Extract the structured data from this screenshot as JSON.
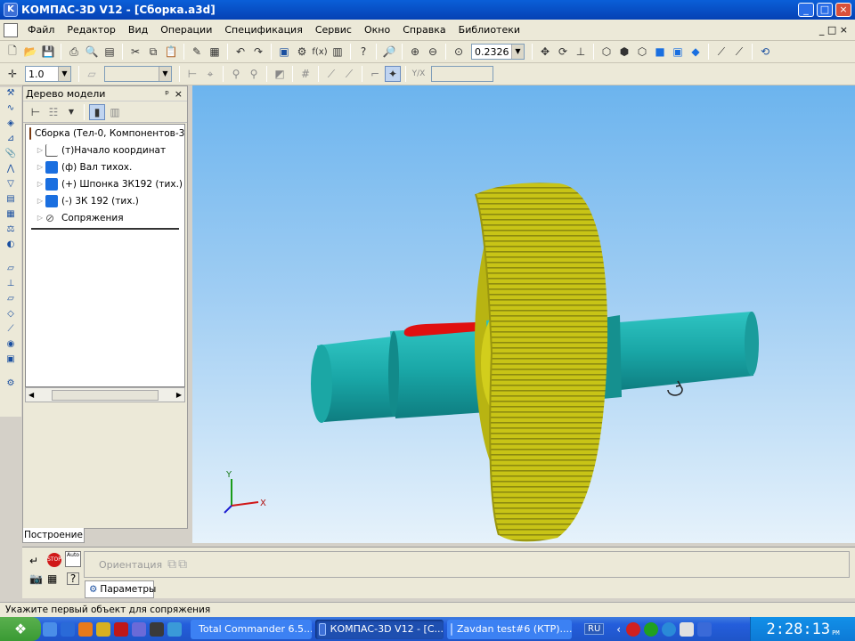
{
  "window": {
    "title": "КОМПАС-3D V12 - [Сборка.a3d]",
    "min": "_",
    "max": "□",
    "close": "×"
  },
  "menu": {
    "items": [
      "Файл",
      "Редактор",
      "Вид",
      "Операции",
      "Спецификация",
      "Сервис",
      "Окно",
      "Справка",
      "Библиотеки"
    ],
    "restore": "_ □ ×"
  },
  "toolbar1": {
    "zoom_value": "0.2326"
  },
  "toolbar2": {
    "step_value": "1.0"
  },
  "tree": {
    "title": "Дерево модели",
    "pin": "ᵖ",
    "close": "×",
    "items": [
      {
        "label": "Сборка (Тел-0, Компонентов-3)"
      },
      {
        "label": "(т)Начало координат"
      },
      {
        "label": "(ф) Вал тихох."
      },
      {
        "label": "(+) Шпонка 3К192 (тих.)"
      },
      {
        "label": "(-) 3К 192 (тих.)"
      },
      {
        "label": "Сопряжения"
      }
    ]
  },
  "tab_construct": "Построение",
  "props": {
    "orientation_label": "Ориентация",
    "params_tab": "Параметры"
  },
  "axes": {
    "x": "X",
    "y": "Y"
  },
  "status": "Укажите первый объект для сопряжения",
  "taskbar": {
    "items": [
      "Total Commander 6.5...",
      "КОМПАС-3D V12 - [C...",
      "Zavdan test#6 (КТР)...."
    ],
    "lang": "RU",
    "clock": "2:28:13",
    "ampm": "PM"
  },
  "colors": {
    "shaft": "#19a6a6",
    "gear": "#c8c416",
    "key": "#e01010",
    "titlebar": "#0a5fd8"
  }
}
